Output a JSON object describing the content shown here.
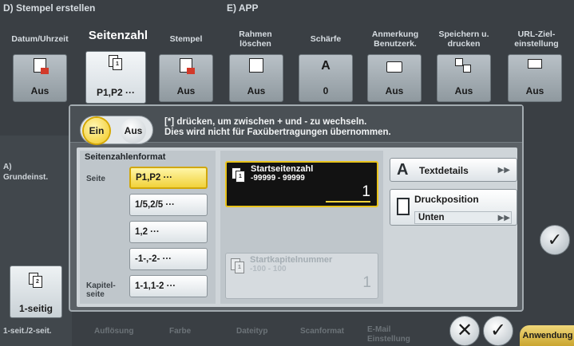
{
  "sections": {
    "d_title": "D)  Stempel erstellen",
    "e_title": "E)  APP"
  },
  "columns": [
    {
      "label": "Datum/Uhrzeit",
      "value": "Aus",
      "icon": "datetime-stamp-icon"
    },
    {
      "label": "Seitenzahl",
      "value": "P1,P2 ···",
      "icon": "page-number-icon",
      "active": true
    },
    {
      "label": "Stempel",
      "value": "Aus",
      "icon": "stamp-icon"
    },
    {
      "label": "Rahmen\nlöschen",
      "value": "Aus",
      "icon": "frame-erase-icon"
    },
    {
      "label": "Schärfe",
      "value": "0",
      "icon": "sharpness-icon"
    },
    {
      "label": "Anmerkung\nBenutzerk.",
      "value": "Aus",
      "icon": "annotation-icon"
    },
    {
      "label": "Speichern u.\ndrucken",
      "value": "Aus",
      "icon": "save-print-icon"
    },
    {
      "label": "URL-Ziel-\neinstellung",
      "value": "Aus",
      "icon": "url-destination-icon"
    }
  ],
  "left_panel": {
    "section": "A)\nGrundeinst.",
    "einseitig_label": "1-seitig"
  },
  "bottom_labels": [
    "1-seit./2-seit.",
    "Auflösung",
    "Farbe",
    "Dateityp",
    "Scanformat",
    "E-Mail\nEinstellung"
  ],
  "popup": {
    "toggle_on": "Ein",
    "toggle_off": "Aus",
    "hint_line1": "[*] drücken, um zwischen + und - zu wechseln.",
    "hint_line2": "Dies wird nicht für Faxübertragungen übernommen.",
    "format_title": "Seitenzahlenformat",
    "seite_label": "Seite",
    "kapitel_label": "Kapitel-\nseite",
    "options": [
      "P1,P2 ···",
      "1/5,2/5 ···",
      "1,2 ···",
      "-1-,-2- ···",
      "1-1,1-2 ···"
    ],
    "selected_option": "P1,P2 ···",
    "start_title": "Startseitenzahl",
    "start_range": "-99999 - 99999",
    "start_value": "1",
    "chapter_title": "Startkapitelnummer",
    "chapter_range": "-100 - 100",
    "chapter_value": "1",
    "text_details": "Textdetails",
    "print_position_title": "Druckposition",
    "print_position_value": "Unten"
  },
  "actions": {
    "cancel_symbol": "✕",
    "ok_symbol": "✓",
    "anwendung": "Anwendung"
  },
  "colors": {
    "accent_yellow": "#f1d23b",
    "panel_gray": "#5b6166",
    "background": "#3a3f44"
  }
}
